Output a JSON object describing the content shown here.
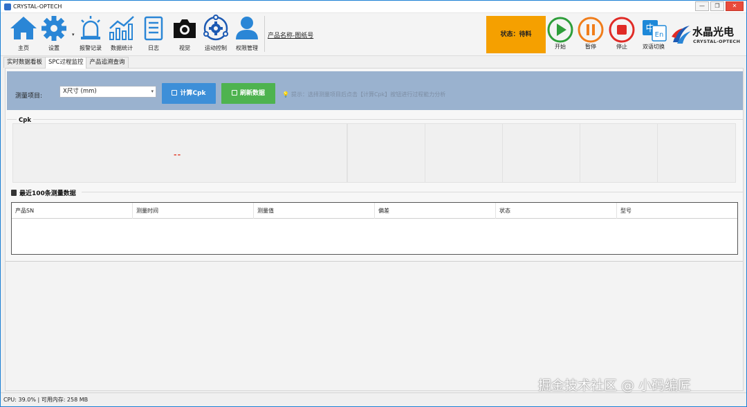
{
  "window": {
    "title": "CRYSTAL-OPTECH",
    "buttons": {
      "minimize": "—",
      "maximize": "❐",
      "close": "✕"
    }
  },
  "toolbar": {
    "items": [
      {
        "label": "主页",
        "icon": "home-icon"
      },
      {
        "label": "设置",
        "icon": "gear-icon"
      },
      {
        "label": "报警记录",
        "icon": "alarm-icon"
      },
      {
        "label": "数据统计",
        "icon": "chart-icon"
      },
      {
        "label": "日志",
        "icon": "log-icon"
      },
      {
        "label": "视觉",
        "icon": "camera-icon"
      },
      {
        "label": "运动控制",
        "icon": "motion-icon"
      },
      {
        "label": "权限管理",
        "icon": "user-icon"
      }
    ],
    "dropdown_arrow": "▾",
    "product_name": "产品名称-图纸号",
    "status": "状态：待料",
    "controls": [
      {
        "label": "开始",
        "icon": "play-icon",
        "color": "#2e9e3a"
      },
      {
        "label": "暂停",
        "icon": "pause-icon",
        "color": "#f07d1a"
      },
      {
        "label": "停止",
        "icon": "stop-icon",
        "color": "#e02b26"
      },
      {
        "label": "双语切换",
        "icon": "language-icon",
        "color": "#1e88d8"
      }
    ],
    "logo": {
      "name": "水晶光电",
      "sub": "CRYSTAL-OPTECH"
    }
  },
  "tabs": [
    {
      "label": "实时数据看板",
      "active": false
    },
    {
      "label": "SPC过程监控",
      "active": true
    },
    {
      "label": "产品追溯查询",
      "active": false
    }
  ],
  "spc": {
    "measure_label": "测量项目:",
    "measure_value": "X尺寸 (mm)",
    "calc_button": "计算Cpk",
    "refresh_button": "刷新数据",
    "hint": "提示：选择测量项目后点击【计算Cpk】按钮进行过程能力分析",
    "cpk_title": "Cpk",
    "cpk_value": "--"
  },
  "recent": {
    "title": "最近100条测量数据",
    "columns": [
      "产品SN",
      "测量时间",
      "测量值",
      "偏差",
      "状态",
      "型号"
    ]
  },
  "statusbar": {
    "text": "CPU: 39.0% | 可用内存: 258 MB"
  },
  "watermark": "掘金技术社区 @ 小码编匠"
}
